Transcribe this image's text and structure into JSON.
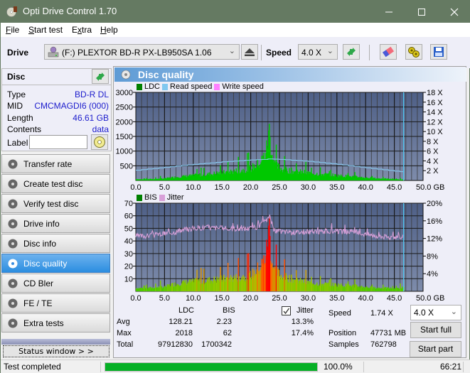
{
  "window": {
    "title": "Opti Drive Control 1.70",
    "controls": [
      "minimize",
      "maximize",
      "close"
    ]
  },
  "menu": {
    "items": [
      {
        "label": "File",
        "accel": "F",
        "rest": "ile"
      },
      {
        "label": "Start test",
        "accel": "S",
        "rest": "tart test"
      },
      {
        "label": "Extra",
        "accel_pre": "E",
        "accel": "x",
        "rest": "tra"
      },
      {
        "label": "Help",
        "accel": "H",
        "rest": "elp"
      }
    ]
  },
  "toolbar": {
    "drive_label": "Drive",
    "drive_value": "(F:)  PLEXTOR BD-R  PX-LB950SA 1.06",
    "speed_label": "Speed",
    "speed_value": "4.0 X",
    "icons": [
      "eject-icon",
      "refresh-icon",
      "eraser-icon",
      "settings-icon",
      "save-icon"
    ]
  },
  "disc": {
    "header": "Disc",
    "fields": [
      {
        "key": "Type",
        "value": "BD-R DL"
      },
      {
        "key": "MID",
        "value": "CMCMAGDI6 (000)"
      },
      {
        "key": "Length",
        "value": "46.61 GB"
      },
      {
        "key": "Contents",
        "value": "data"
      }
    ],
    "label_key": "Label",
    "label_value": ""
  },
  "nav": {
    "items": [
      {
        "label": "Transfer rate",
        "active": false
      },
      {
        "label": "Create test disc",
        "active": false
      },
      {
        "label": "Verify test disc",
        "active": false
      },
      {
        "label": "Drive info",
        "active": false
      },
      {
        "label": "Disc info",
        "active": false
      },
      {
        "label": "Disc quality",
        "active": true
      },
      {
        "label": "CD Bler",
        "active": false
      },
      {
        "label": "FE / TE",
        "active": false
      },
      {
        "label": "Extra tests",
        "active": false
      }
    ],
    "status_window": "Status window > >"
  },
  "panel": {
    "title": "Disc quality"
  },
  "colors": {
    "ldc": "#00c000",
    "read_speed": "#80c8f0",
    "write_speed": "#ff80ff",
    "jitter": "#d8a0d8",
    "plot_bg_top": "#4e5f86",
    "plot_bg_bottom": "#7a88a8",
    "accent_blue": "#1c1ccc",
    "progress": "#06b025"
  },
  "chart_data": [
    {
      "type": "area",
      "title": "LDC / Read speed",
      "legend": [
        "LDC",
        "Read speed",
        "Write speed"
      ],
      "legend_position": "top-left",
      "x_ticks": [
        "0.0",
        "5.0",
        "10.0",
        "15.0",
        "20.0",
        "25.0",
        "30.0",
        "35.0",
        "40.0",
        "45.0",
        "50.0 GB"
      ],
      "xlim": [
        0,
        50
      ],
      "y_left_ticks": [
        "500",
        "1000",
        "1500",
        "2000",
        "2500",
        "3000"
      ],
      "ylim_left": [
        0,
        3000
      ],
      "y_right_ticks": [
        "2 X",
        "4 X",
        "6 X",
        "8 X",
        "10 X",
        "12 X",
        "14 X",
        "16 X",
        "18 X"
      ],
      "ylim_right": [
        0,
        18
      ],
      "end_marker_gb": 46.61,
      "series": [
        {
          "name": "LDC",
          "x": [
            0,
            1,
            2,
            3,
            4,
            5,
            6,
            7,
            8,
            9,
            10,
            11,
            12,
            13,
            14,
            15,
            16,
            17,
            18,
            19,
            20,
            20.5,
            21,
            21.5,
            22,
            22.5,
            22.8,
            23,
            23.2,
            23.5,
            24,
            24.5,
            25,
            26,
            27,
            28,
            29,
            30,
            31,
            32,
            33,
            34,
            35,
            36,
            37,
            38,
            39,
            40,
            41,
            42,
            43,
            44,
            45,
            46,
            46.6
          ],
          "values": [
            60,
            40,
            50,
            60,
            70,
            80,
            110,
            140,
            160,
            180,
            200,
            220,
            240,
            260,
            290,
            310,
            340,
            370,
            400,
            430,
            480,
            560,
            620,
            720,
            850,
            1100,
            1400,
            1700,
            2018,
            1200,
            700,
            560,
            500,
            420,
            380,
            350,
            330,
            300,
            280,
            260,
            240,
            220,
            200,
            180,
            170,
            150,
            130,
            110,
            100,
            80,
            70,
            60,
            50,
            40,
            30
          ]
        },
        {
          "name": "Read speed",
          "unit": "X",
          "x": [
            0,
            5,
            10,
            15,
            20,
            22,
            23.3,
            25,
            30,
            35,
            40,
            45,
            46.6
          ],
          "values": [
            2.1,
            2.7,
            3.3,
            3.8,
            4.2,
            4.3,
            4.4,
            4.3,
            3.9,
            3.3,
            2.6,
            1.9,
            1.74
          ]
        }
      ]
    },
    {
      "type": "area",
      "title": "BIS / Jitter",
      "legend": [
        "BIS",
        "Jitter"
      ],
      "legend_position": "top-left",
      "x_ticks": [
        "0.0",
        "5.0",
        "10.0",
        "15.0",
        "20.0",
        "25.0",
        "30.0",
        "35.0",
        "40.0",
        "45.0",
        "50.0 GB"
      ],
      "xlim": [
        0,
        50
      ],
      "y_left_ticks": [
        "10",
        "20",
        "30",
        "40",
        "50",
        "60",
        "70"
      ],
      "ylim_left": [
        0,
        70
      ],
      "y_right_ticks": [
        "4%",
        "8%",
        "12%",
        "16%",
        "20%"
      ],
      "ylim_right": [
        0,
        20
      ],
      "end_marker_gb": 46.61,
      "series": [
        {
          "name": "BIS",
          "x": [
            0,
            2,
            4,
            5,
            6,
            8,
            10,
            12,
            14,
            16,
            18,
            19,
            20,
            20.5,
            21,
            21.5,
            22,
            22.5,
            22.8,
            23,
            23.2,
            23.5,
            24,
            25,
            26,
            28,
            30,
            32,
            35,
            38,
            40,
            42,
            44,
            46,
            46.6
          ],
          "values": [
            3,
            3,
            4,
            4,
            6,
            8,
            9,
            10,
            11,
            12,
            13,
            14,
            15,
            17,
            20,
            22,
            26,
            33,
            42,
            52,
            62,
            30,
            20,
            15,
            13,
            10,
            8,
            7,
            6,
            5,
            4,
            3,
            3,
            3,
            4
          ]
        },
        {
          "name": "Jitter",
          "unit": "%",
          "x": [
            0,
            2,
            4,
            6,
            8,
            10,
            12,
            14,
            16,
            18,
            20,
            21,
            22,
            22.5,
            23,
            23.3,
            24,
            25,
            27,
            30,
            33,
            35,
            38,
            40,
            42,
            44,
            46,
            46.6
          ],
          "values": [
            12.5,
            12.6,
            12.9,
            13.3,
            13.8,
            14.3,
            14.5,
            14.4,
            14.2,
            14.2,
            14.3,
            14.6,
            15.3,
            15.8,
            16.3,
            17.4,
            13.8,
            13.6,
            13.4,
            13.5,
            13.6,
            13.6,
            13.4,
            13.0,
            12.6,
            12.3,
            12.4,
            12.3
          ]
        }
      ]
    }
  ],
  "stats": {
    "col_ldc": "LDC",
    "col_bis": "BIS",
    "jitter_label": "Jitter",
    "jitter_checked": true,
    "rows": [
      {
        "label": "Avg",
        "ldc": "128.21",
        "bis": "2.23",
        "jitter": "13.3%"
      },
      {
        "label": "Max",
        "ldc": "2018",
        "bis": "62",
        "jitter": "17.4%"
      },
      {
        "label": "Total",
        "ldc": "97912830",
        "bis": "1700342",
        "jitter": ""
      }
    ],
    "speed_label": "Speed",
    "speed_value": "1.74 X",
    "position_label": "Position",
    "position_value": "47731 MB",
    "samples_label": "Samples",
    "samples_value": "762798",
    "speed_select": "4.0 X",
    "start_full": "Start full",
    "start_part": "Start part"
  },
  "statusbar": {
    "message": "Test completed",
    "progress": 100.0,
    "progress_text": "100.0%",
    "elapsed": "66:21"
  }
}
